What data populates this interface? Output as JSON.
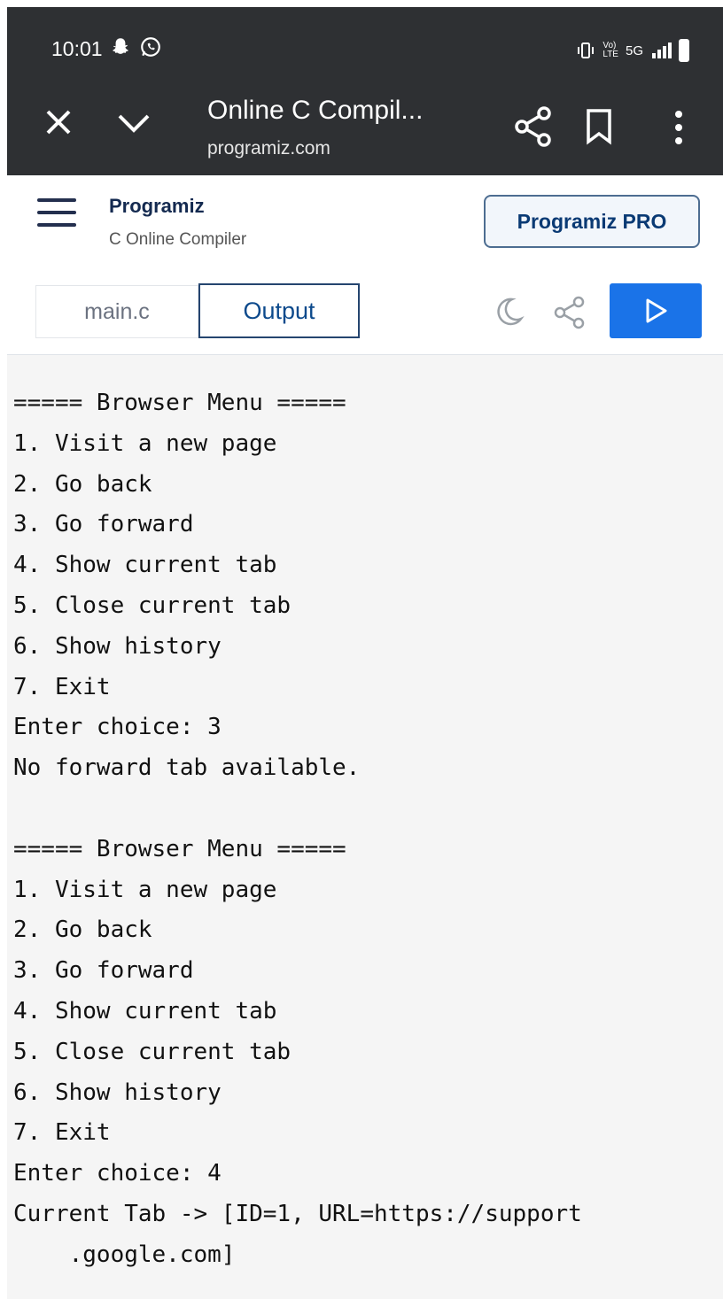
{
  "status": {
    "time": "10:01",
    "network": "5G"
  },
  "browser": {
    "title": "Online C Compil...",
    "domain": "programiz.com"
  },
  "app": {
    "logo_text": "Programiz",
    "subtitle": "C Online Compiler",
    "pro_button": "Programiz PRO"
  },
  "editor": {
    "tab_file": "main.c",
    "tab_output": "Output"
  },
  "output_lines": [
    "===== Browser Menu =====",
    "1. Visit a new page",
    "2. Go back",
    "3. Go forward",
    "4. Show current tab",
    "5. Close current tab",
    "6. Show history",
    "7. Exit",
    "Enter choice: 3",
    "No forward tab available.",
    "",
    "===== Browser Menu =====",
    "1. Visit a new page",
    "2. Go back",
    "3. Go forward",
    "4. Show current tab",
    "5. Close current tab",
    "6. Show history",
    "7. Exit",
    "Enter choice: 4",
    "Current Tab -> [ID=1, URL=https://support",
    "    .google.com]"
  ],
  "icons": {
    "snapchat": "snapchat-icon",
    "whatsapp": "whatsapp-icon",
    "close": "close-icon",
    "chevron": "chevron-down-icon",
    "share": "share-icon",
    "bookmark": "bookmark-icon",
    "more": "more-vertical-icon",
    "menu": "hamburger-icon",
    "moon": "moon-icon",
    "run": "play-icon"
  },
  "colors": {
    "browser_bar": "#2e3033",
    "run_button": "#1a73e8",
    "output_bg": "#f5f5f5"
  }
}
